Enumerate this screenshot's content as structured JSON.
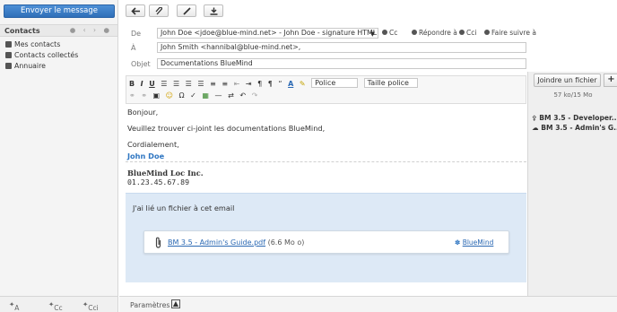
{
  "left": {
    "send_label": "Envoyer le message",
    "contacts_title": "Contacts",
    "pager": "● ‹ › ●",
    "books": [
      "Mes contacts",
      "Contacts collectés",
      "Annuaire"
    ],
    "footer": {
      "a": "A",
      "cc": "Cc",
      "cci": "Cci"
    }
  },
  "toolbar": {
    "icons": [
      "arrow-left-icon",
      "paperclip-icon",
      "pen-icon",
      "save-icon"
    ]
  },
  "fields": {
    "from_label": "De",
    "from_value": "John Doe <jdoe@blue-mind.net> - John Doe - signature HTML",
    "to_label": "À",
    "to_value": "John Smith <hannibal@blue-mind.net>,",
    "subject_label": "Objet",
    "subject_value": "Documentations BlueMind",
    "options": [
      "Cc",
      "Répondre à",
      "Cci",
      "Faire suivre à"
    ]
  },
  "editor": {
    "font_placeholder": "Police",
    "size_placeholder": "Taille police"
  },
  "body": {
    "greeting": "Bonjour,",
    "line1": "Veuillez trouver ci-joint les documentations BlueMind,",
    "closing": "Cordialement,",
    "sig_name": "John Doe",
    "company": "BlueMind Loc Inc.",
    "phone": "01.23.45.67.89"
  },
  "attachment_panel": {
    "intro": "J'ai lié un fichier à cet email",
    "file_name": "BM 3.5 - Admin's Guide.pdf",
    "file_size": "(6.6 Mo o)",
    "brand": "BlueMind"
  },
  "right": {
    "join_label": "Joindre un fichier",
    "quota": "57 ko/15 Mo",
    "files": [
      "BM 3.5 - Developer...",
      "BM 3.5 - Admin's G..."
    ]
  },
  "footer": {
    "params_label": "Paramètres"
  }
}
